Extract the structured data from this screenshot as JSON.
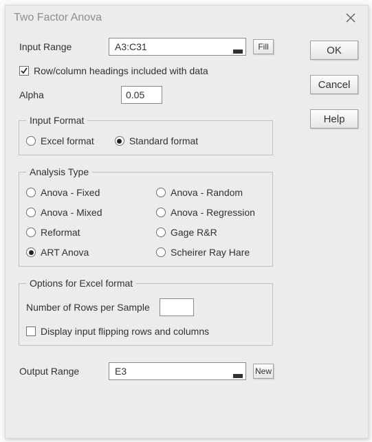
{
  "window": {
    "title": "Two Factor Anova"
  },
  "inputRange": {
    "label": "Input Range",
    "value": "A3:C31",
    "fillBtn": "Fill"
  },
  "headingsCheck": {
    "label": "Row/column headings included with data",
    "checked": true
  },
  "alpha": {
    "label": "Alpha",
    "value": "0.05"
  },
  "inputFormat": {
    "legend": "Input Format",
    "options": {
      "excel": {
        "label": "Excel format",
        "checked": false
      },
      "standard": {
        "label": "Standard format",
        "checked": true
      }
    }
  },
  "analysisType": {
    "legend": "Analysis Type",
    "options": {
      "fixed": {
        "label": "Anova - Fixed",
        "checked": false
      },
      "mixed": {
        "label": "Anova - Mixed",
        "checked": false
      },
      "reformat": {
        "label": "Reformat",
        "checked": false
      },
      "art": {
        "label": "ART Anova",
        "checked": true
      },
      "random": {
        "label": "Anova - Random",
        "checked": false
      },
      "regression": {
        "label": "Anova - Regression",
        "checked": false
      },
      "gagerr": {
        "label": "Gage R&R",
        "checked": false
      },
      "scheirer": {
        "label": "Scheirer Ray Hare",
        "checked": false
      }
    }
  },
  "optionsExcel": {
    "legend": "Options for Excel format",
    "rowsLabel": "Number of Rows per Sample",
    "rowsValue": "",
    "flipCheck": {
      "label": "Display input flipping rows and columns",
      "checked": false
    }
  },
  "outputRange": {
    "label": "Output Range",
    "value": "E3",
    "newBtn": "New"
  },
  "sideButtons": {
    "ok": "OK",
    "cancel": "Cancel",
    "help": "Help"
  }
}
